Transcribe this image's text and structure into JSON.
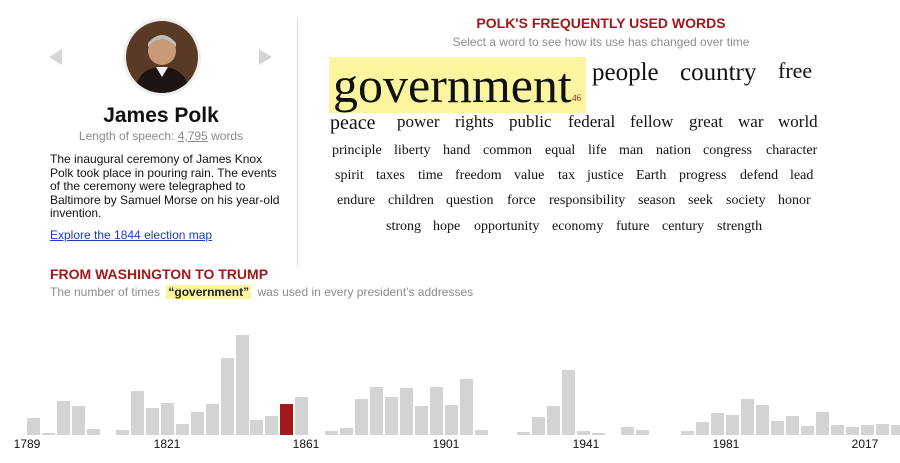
{
  "president": {
    "name": "James Polk",
    "speech_length_label": "Length of speech:",
    "speech_length": "4,795",
    "speech_length_unit": "words",
    "description": "The inaugural ceremony of James Knox Polk took place in pouring rain. The events of the ceremony were telegraphed to Baltimore by Samuel Morse on his year-old invention.",
    "map_link": "Explore the 1844 election map"
  },
  "word_cloud": {
    "title": "POLK'S FREQUENTLY USED WORDS",
    "subtitle": "Select a word to see how its use has changed over time",
    "selected_count": "46",
    "rows": [
      [
        "government",
        "people",
        "country",
        "free"
      ],
      [
        "peace",
        "power",
        "rights",
        "public",
        "federal",
        "fellow",
        "great",
        "war",
        "world"
      ],
      [
        "principle",
        "liberty",
        "hand",
        "common",
        "equal",
        "life",
        "man",
        "nation",
        "congress",
        "character"
      ],
      [
        "spirit",
        "taxes",
        "time",
        "freedom",
        "value",
        "tax",
        "justice",
        "Earth",
        "progress",
        "defend",
        "lead"
      ],
      [
        "endure",
        "children",
        "question",
        "force",
        "responsibility",
        "season",
        "seek",
        "society",
        "honor"
      ],
      [
        "strong",
        "hope",
        "opportunity",
        "economy",
        "future",
        "century",
        "strength"
      ]
    ]
  },
  "history": {
    "title": "FROM WASHINGTON TO TRUMP",
    "subtitle_before": "The number of times",
    "subtitle_word": "“government”",
    "subtitle_after": "was used in every president's addresses"
  },
  "colors": {
    "accent": "#a31818",
    "bar": "#d3d3d3",
    "bar_selected": "#a31818",
    "highlight": "#fbf5a0"
  },
  "chart_data": {
    "type": "bar",
    "x_label_ticks": [
      "1789",
      "1821",
      "1861",
      "1901",
      "1941",
      "1981",
      "2017"
    ],
    "ylim": [
      0,
      100
    ],
    "selected_index": 16,
    "groups": [
      [
        17,
        2,
        34,
        29,
        6
      ],
      [
        5,
        44,
        27,
        32,
        11,
        23,
        31,
        77,
        100
      ],
      [
        15,
        19,
        31,
        38
      ],
      [
        4,
        7,
        36,
        48,
        38,
        47,
        29,
        48,
        30,
        56,
        5
      ],
      [
        3,
        18,
        29,
        65,
        4,
        2
      ],
      [
        8,
        5
      ],
      [
        4,
        13,
        22,
        20,
        36,
        30,
        14,
        19,
        9,
        23,
        10,
        8,
        10,
        11,
        10,
        13
      ]
    ]
  }
}
